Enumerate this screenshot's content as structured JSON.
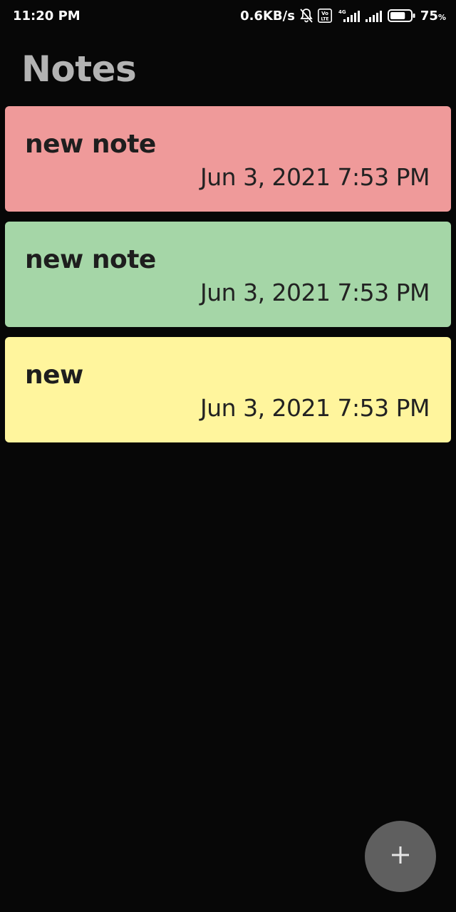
{
  "status_bar": {
    "time": "11:20 PM",
    "network_speed": "0.6KB/s",
    "volte_label_top": "Vo",
    "volte_label_bottom": "LTE",
    "network_type": "4G",
    "battery_percent": "75",
    "battery_unit": "%",
    "battery_level": 0.75,
    "icons": [
      "bell-muted-icon",
      "volte-icon",
      "signal-4g-icon",
      "signal-icon",
      "battery-icon"
    ]
  },
  "header": {
    "title": "Notes"
  },
  "notes": [
    {
      "title": "new note",
      "date": "Jun 3, 2021 7:53 PM",
      "color": "#ef9a9a"
    },
    {
      "title": "new note",
      "date": "Jun 3, 2021 7:53 PM",
      "color": "#a5d6a7"
    },
    {
      "title": "new",
      "date": "Jun 3, 2021 7:53 PM",
      "color": "#fff59d"
    }
  ],
  "fab": {
    "icon": "plus-icon",
    "color": "#5f5f5f"
  },
  "colors": {
    "background": "#070707",
    "title": "#b3b3b3"
  }
}
